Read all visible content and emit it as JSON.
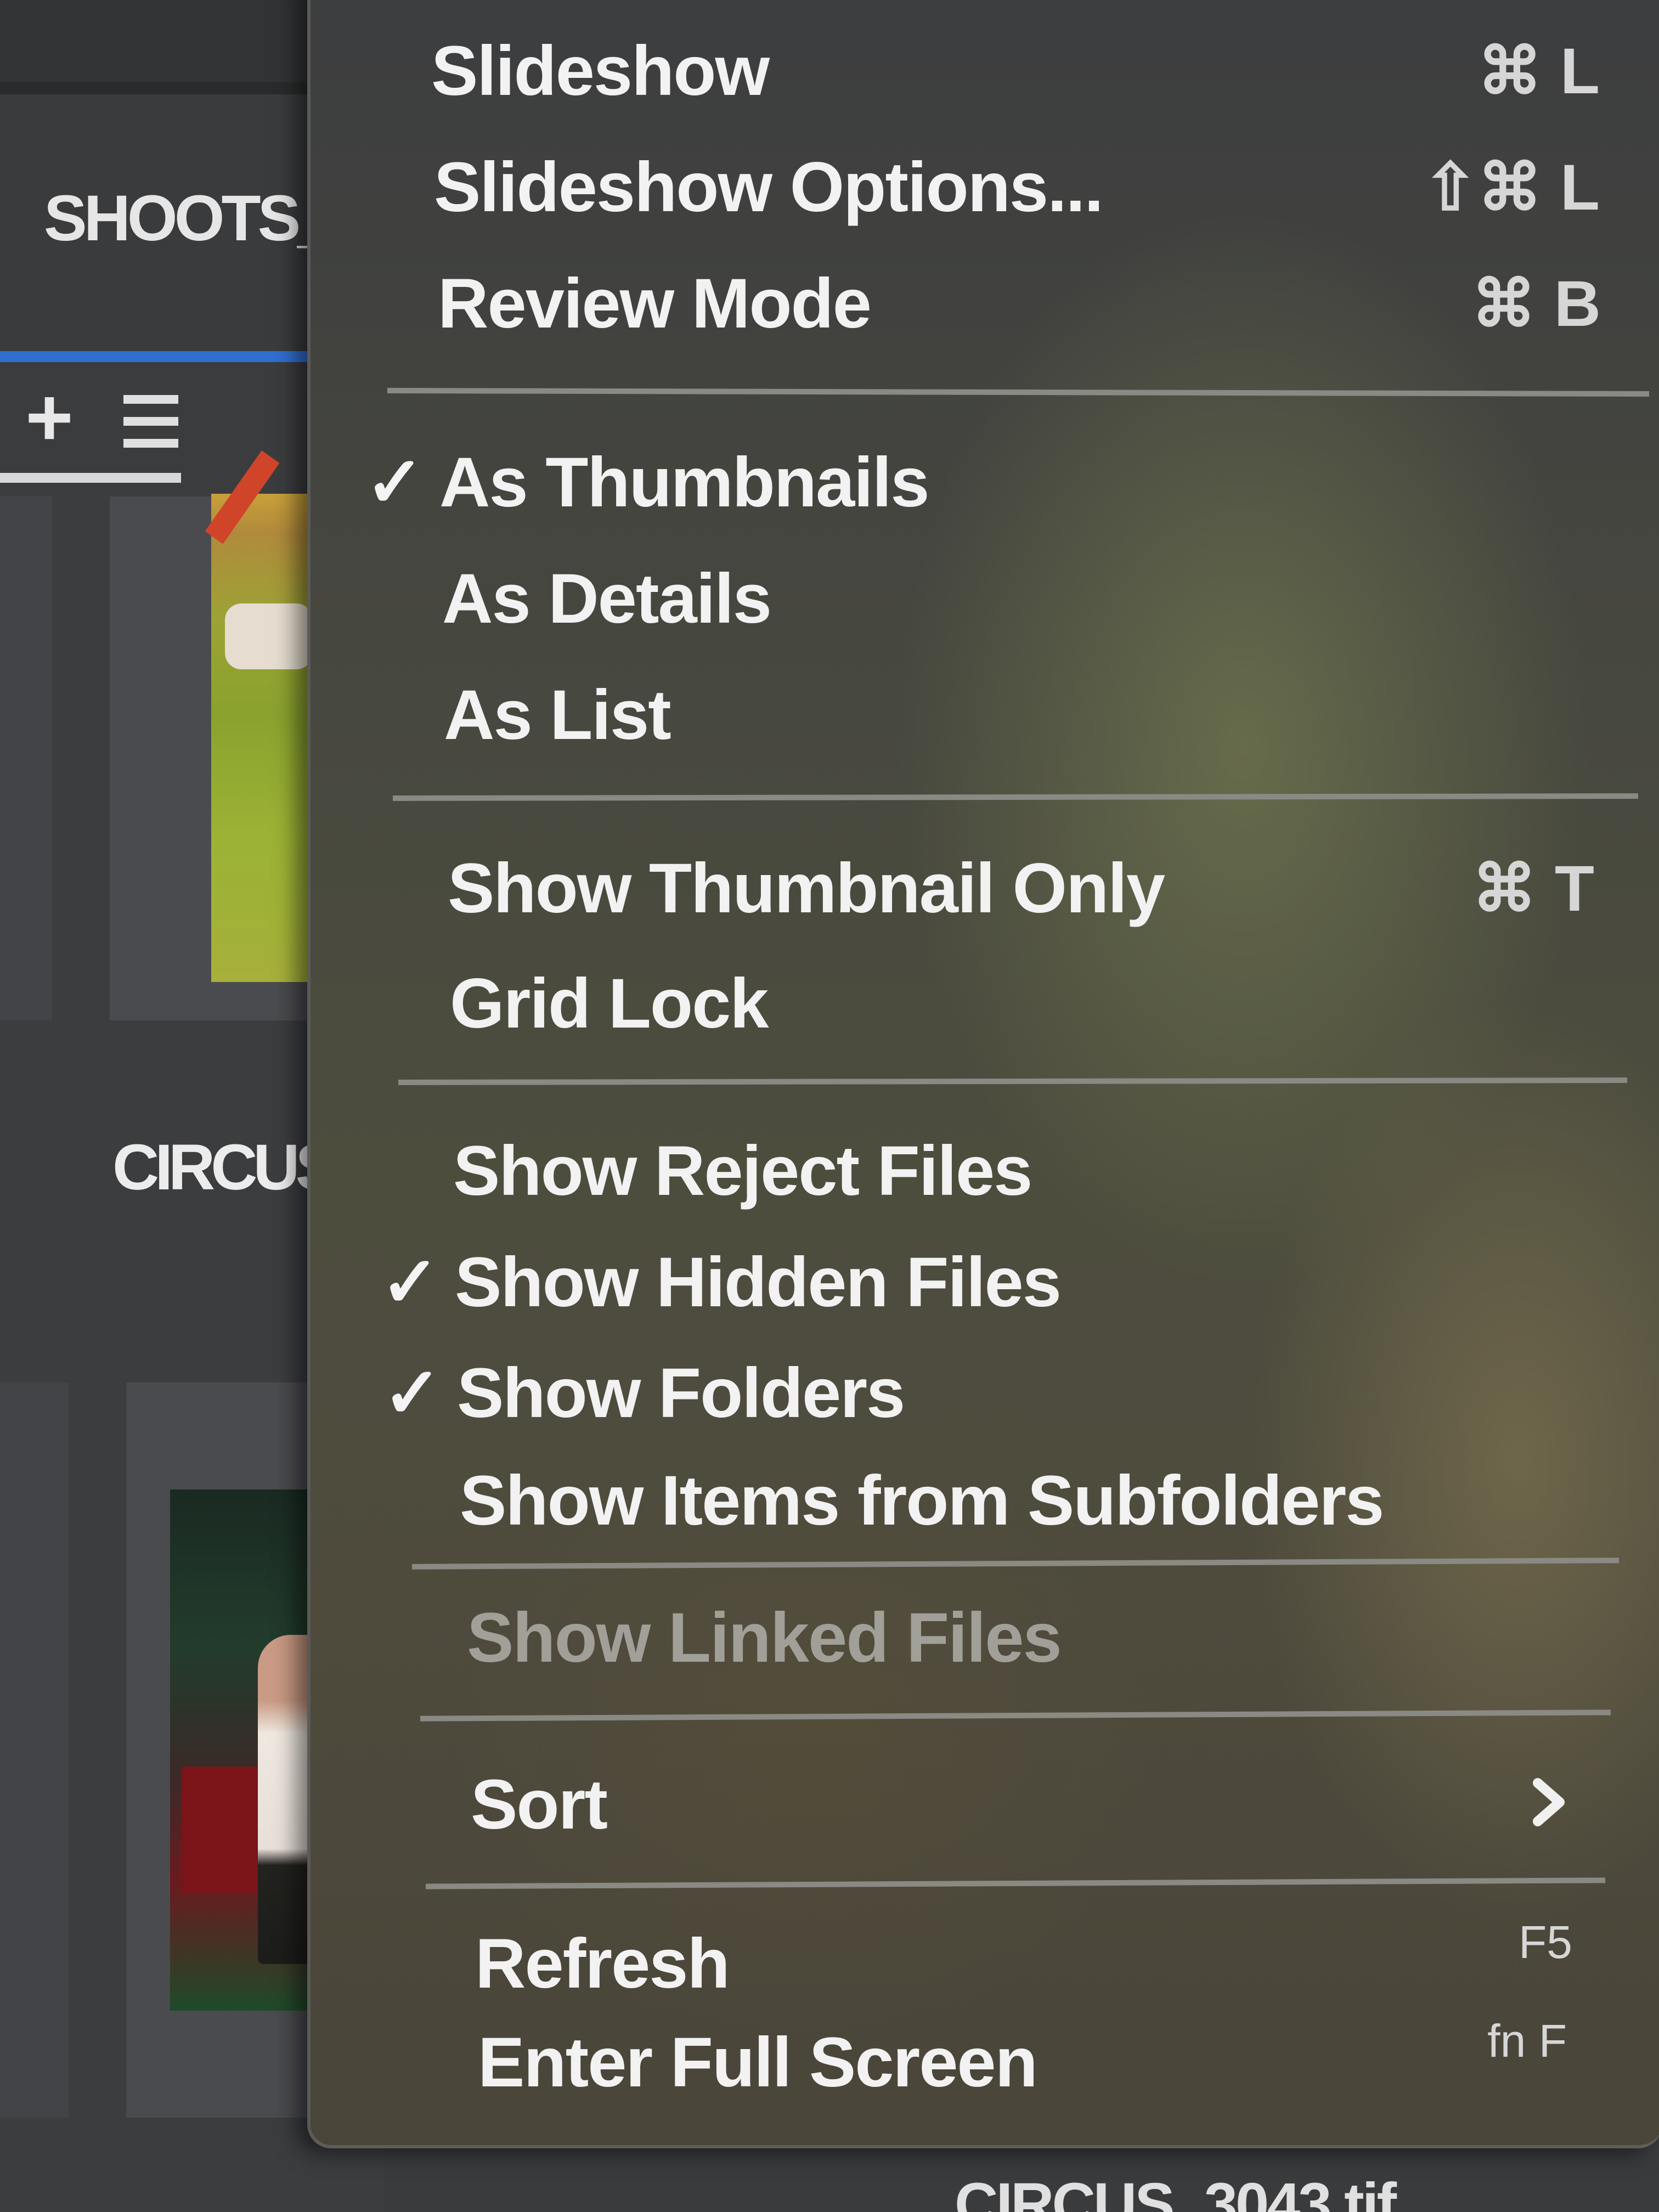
{
  "background": {
    "tab_label": "SHOOTS_",
    "folder_label": "CIRCUS_",
    "bottom_filename": "CIRCUS_3043.tif",
    "toolbar_add_icon": "plus-icon",
    "toolbar_menu_icon": "hamburger-menu-icon",
    "accent_color": "#2f6fd0"
  },
  "menu": {
    "items": [
      {
        "label": "Slideshow",
        "shortcut": "⌘ L",
        "checked": false
      },
      {
        "label": "Slideshow Options...",
        "shortcut": "⇧⌘ L",
        "checked": false
      },
      {
        "label": "Review Mode",
        "shortcut": "⌘ B",
        "checked": false
      },
      {
        "label": "As Thumbnails",
        "shortcut": "",
        "checked": true
      },
      {
        "label": "As Details",
        "shortcut": "",
        "checked": false
      },
      {
        "label": "As List",
        "shortcut": "",
        "checked": false
      },
      {
        "label": "Show Thumbnail Only",
        "shortcut": "⌘ T",
        "checked": false
      },
      {
        "label": "Grid Lock",
        "shortcut": "",
        "checked": false
      },
      {
        "label": "Show Reject Files",
        "shortcut": "",
        "checked": false
      },
      {
        "label": "Show Hidden Files",
        "shortcut": "",
        "checked": true
      },
      {
        "label": "Show Folders",
        "shortcut": "",
        "checked": true
      },
      {
        "label": "Show Items from Subfolders",
        "shortcut": "",
        "checked": false
      },
      {
        "label": "Show Linked Files",
        "shortcut": "",
        "checked": false,
        "disabled": true
      },
      {
        "label": "Sort",
        "shortcut": "",
        "checked": false,
        "submenu": true
      },
      {
        "label": "Refresh",
        "shortcut": "F5",
        "checked": false
      },
      {
        "label": "Enter Full Screen",
        "shortcut": "fn F",
        "checked": false
      }
    ],
    "check_glyph": "✓",
    "submenu_icon": "chevron-right-icon"
  }
}
